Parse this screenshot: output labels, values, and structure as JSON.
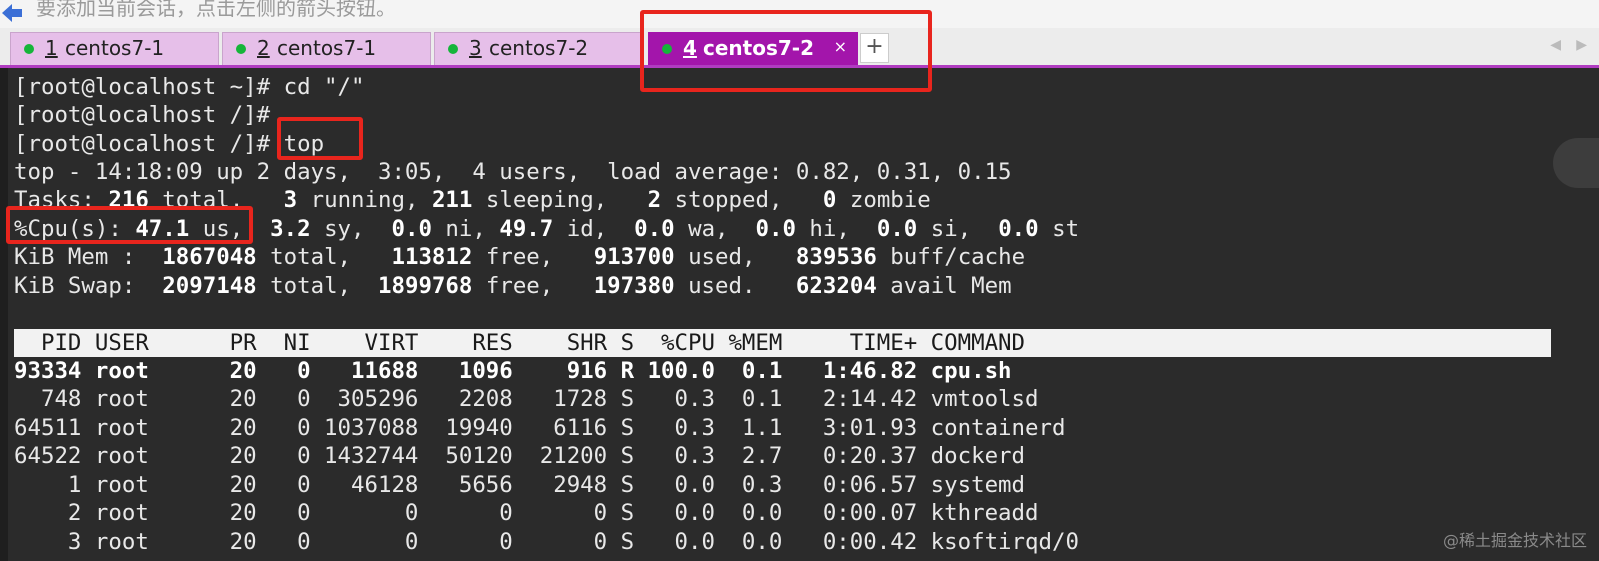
{
  "hint": {
    "text": "要添加当前会话，点击左侧的箭头按钮。",
    "icon": "arrow-icon"
  },
  "tabs": [
    {
      "num": "1",
      "label": "centos7-1",
      "status_color": "#15b53a",
      "active": false
    },
    {
      "num": "2",
      "label": "centos7-1",
      "status_color": "#15b53a",
      "active": false
    },
    {
      "num": "3",
      "label": "centos7-2",
      "status_color": "#15b53a",
      "active": false
    },
    {
      "num": "4",
      "label": "centos7-2",
      "status_color": "#15b53a",
      "active": true,
      "close": "×"
    }
  ],
  "add_tab": "+",
  "tab_scroll": {
    "left": "◀",
    "right": "▶"
  },
  "terminal": {
    "lines": [
      "[root@localhost ~]# cd \"/\"",
      "[root@localhost /]#",
      "[root@localhost /]# top",
      "top - 14:18:09 up 2 days,  3:05,  4 users,  load average: 0.82, 0.31, 0.15"
    ],
    "tasks": {
      "prefix": "Tasks: ",
      "total": "216",
      "t1": " total,   ",
      "running": "3",
      "t2": " running, ",
      "sleeping": "211",
      "t3": " sleeping,   ",
      "stopped": "2",
      "t4": " stopped,   ",
      "zombie": "0",
      "t5": " zombie"
    },
    "cpu": {
      "prefix": "%Cpu(s): ",
      "us": "47.1",
      "t1": " us,  ",
      "sy": "3.2",
      "t2": " sy,  ",
      "ni": "0.0",
      "t3": " ni, ",
      "id": "49.7",
      "t4": " id,  ",
      "wa": "0.0",
      "t5": " wa,  ",
      "hi": "0.0",
      "t6": " hi,  ",
      "si": "0.0",
      "t7": " si,  ",
      "st": "0.0",
      "t8": " st"
    },
    "mem": {
      "prefix": "KiB Mem :  ",
      "total": "1867048",
      "t1": " total,   ",
      "free": "113812",
      "t2": " free,   ",
      "used": "913700",
      "t3": " used,   ",
      "buff": "839536",
      "t4": " buff/cache"
    },
    "swap": {
      "prefix": "KiB Swap:  ",
      "total": "2097148",
      "t1": " total,  ",
      "free": "1899768",
      "t2": " free,   ",
      "used": "197380",
      "t3": " used.   ",
      "avail": "623204",
      "t4": " avail Mem"
    },
    "header": "  PID USER      PR  NI    VIRT    RES    SHR S  %CPU %MEM     TIME+ COMMAND",
    "processes": [
      {
        "text": "93334 root      20   0   11688   1096    916 R 100.0  0.1   1:46.82 cpu.sh",
        "bold": true
      },
      {
        "text": "  748 root      20   0  305296   2208   1728 S   0.3  0.1   2:14.42 vmtoolsd",
        "bold": false
      },
      {
        "text": "64511 root      20   0 1037088  19940   6116 S   0.3  1.1   3:01.93 containerd",
        "bold": false
      },
      {
        "text": "64522 root      20   0 1432744  50120  21200 S   0.3  2.7   0:20.37 dockerd",
        "bold": false
      },
      {
        "text": "    1 root      20   0   46128   5656   2948 S   0.0  0.3   0:06.57 systemd",
        "bold": false
      },
      {
        "text": "    2 root      20   0       0      0      0 S   0.0  0.0   0:00.07 kthreadd",
        "bold": false
      },
      {
        "text": "    3 root      20   0       0      0      0 S   0.0  0.0   0:00.42 ksoftirqd/0",
        "bold": false
      }
    ]
  },
  "watermark": "@稀土掘金技术社区",
  "colors": {
    "active_tab": "#a315ab",
    "inactive_tab": "#e6bfe9",
    "highlight": "#e8251d",
    "status_dot": "#15b53a"
  }
}
